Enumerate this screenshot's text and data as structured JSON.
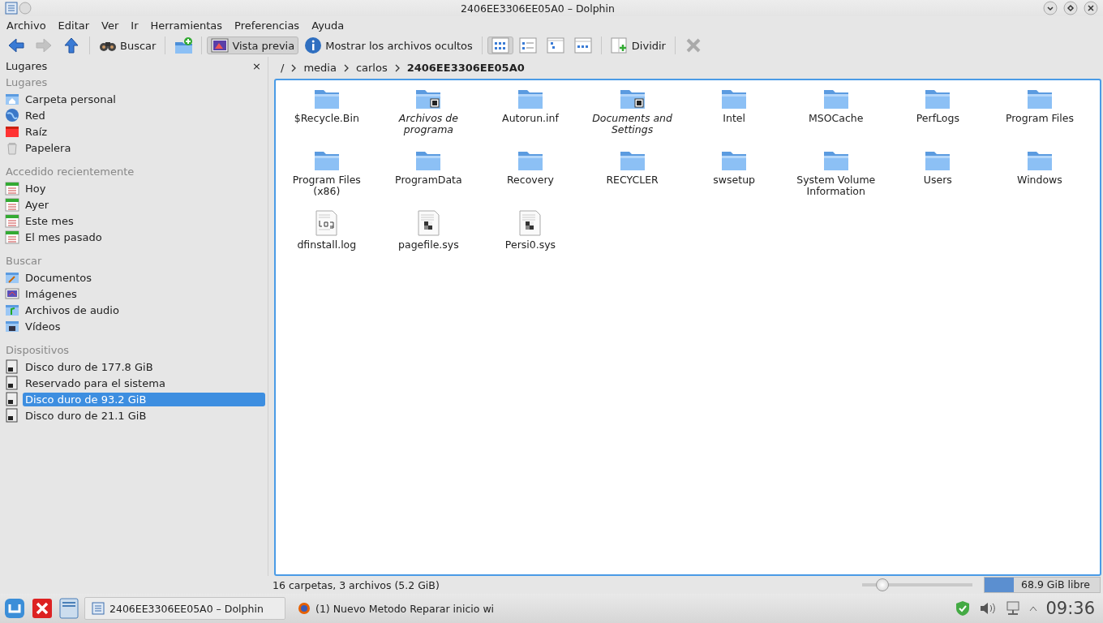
{
  "window": {
    "title": "2406EE3306EE05A0 – Dolphin"
  },
  "menu": [
    "Archivo",
    "Editar",
    "Ver",
    "Ir",
    "Herramientas",
    "Preferencias",
    "Ayuda"
  ],
  "toolbar": [
    {
      "kind": "back",
      "disabled": false
    },
    {
      "kind": "forward",
      "disabled": true
    },
    {
      "kind": "up",
      "disabled": false
    },
    {
      "kind": "sep"
    },
    {
      "kind": "search",
      "label": "Buscar"
    },
    {
      "kind": "sep"
    },
    {
      "kind": "newfolder"
    },
    {
      "kind": "sep"
    },
    {
      "kind": "preview",
      "label": "Vista previa",
      "selected": true
    },
    {
      "kind": "info",
      "label": "Mostrar los archivos ocultos",
      "selected": false
    },
    {
      "kind": "sep"
    },
    {
      "kind": "viewicons",
      "selected": true
    },
    {
      "kind": "viewcompact",
      "selected": false
    },
    {
      "kind": "viewdetails",
      "selected": false
    },
    {
      "kind": "viewcolumns",
      "selected": false
    },
    {
      "kind": "sep"
    },
    {
      "kind": "split",
      "label": "Dividir"
    },
    {
      "kind": "sep"
    },
    {
      "kind": "close"
    }
  ],
  "sidebar": {
    "title": "Lugares",
    "close": "×",
    "sections": [
      {
        "heading": "Lugares",
        "items": [
          {
            "label": "Carpeta personal",
            "kind": "home",
            "selected": false
          },
          {
            "label": "Red",
            "kind": "network",
            "selected": false
          },
          {
            "label": "Raíz",
            "kind": "root",
            "selected": false
          },
          {
            "label": "Papelera",
            "kind": "trash",
            "selected": false
          }
        ]
      },
      {
        "heading": "Accedido recientemente",
        "items": [
          {
            "label": "Hoy",
            "kind": "calendar",
            "selected": false
          },
          {
            "label": "Ayer",
            "kind": "calendar",
            "selected": false
          },
          {
            "label": "Este mes",
            "kind": "calendar",
            "selected": false
          },
          {
            "label": "El mes pasado",
            "kind": "calendar",
            "selected": false
          }
        ]
      },
      {
        "heading": "Buscar",
        "items": [
          {
            "label": "Documentos",
            "kind": "documents",
            "selected": false
          },
          {
            "label": "Imágenes",
            "kind": "images",
            "selected": false
          },
          {
            "label": "Archivos de audio",
            "kind": "audio",
            "selected": false
          },
          {
            "label": "Vídeos",
            "kind": "videos",
            "selected": false
          }
        ]
      },
      {
        "heading": "Dispositivos",
        "items": [
          {
            "label": "Disco duro de 177.8 GiB",
            "kind": "disk",
            "selected": false
          },
          {
            "label": "Reservado para el sistema",
            "kind": "disk",
            "selected": false
          },
          {
            "label": "Disco duro de 93.2 GiB",
            "kind": "disk",
            "selected": true
          },
          {
            "label": "Disco duro de 21.1 GiB",
            "kind": "disk",
            "selected": false
          }
        ]
      }
    ]
  },
  "breadcrumb": [
    {
      "label": "/",
      "current": false
    },
    {
      "label": "media",
      "current": false
    },
    {
      "label": "carlos",
      "current": false
    },
    {
      "label": "2406EE3306EE05A0",
      "current": true
    }
  ],
  "files": [
    {
      "name": "$Recycle.Bin",
      "kind": "folder"
    },
    {
      "name": "Archivos de programa",
      "kind": "link"
    },
    {
      "name": "Autorun.inf",
      "kind": "folder"
    },
    {
      "name": "Documents and Settings",
      "kind": "link"
    },
    {
      "name": "Intel",
      "kind": "folder"
    },
    {
      "name": "MSOCache",
      "kind": "folder"
    },
    {
      "name": "PerfLogs",
      "kind": "folder"
    },
    {
      "name": "Program Files",
      "kind": "folder"
    },
    {
      "name": "Program Files (x86)",
      "kind": "folder"
    },
    {
      "name": "ProgramData",
      "kind": "folder"
    },
    {
      "name": "Recovery",
      "kind": "folder"
    },
    {
      "name": "RECYCLER",
      "kind": "folder"
    },
    {
      "name": "swsetup",
      "kind": "folder"
    },
    {
      "name": "System Volume Information",
      "kind": "folder"
    },
    {
      "name": "Users",
      "kind": "folder"
    },
    {
      "name": "Windows",
      "kind": "folder"
    },
    {
      "name": "dfinstall.log",
      "kind": "log"
    },
    {
      "name": "pagefile.sys",
      "kind": "sys"
    },
    {
      "name": "Persi0.sys",
      "kind": "sys"
    }
  ],
  "status_bar": {
    "text": "16 carpetas, 3 archivos (5.2 GiB)",
    "zoom": {
      "level": 0.14
    },
    "free_space": {
      "label": "68.9 GiB libre",
      "level": 0.25
    }
  },
  "taskbar": {
    "tasks": [
      {
        "label": "2406EE3306EE05A0 – Dolphin",
        "selected": true
      },
      {
        "label": "(1) Nuevo Metodo Reparar inicio wi",
        "selected": false
      }
    ],
    "clock": "09:36"
  }
}
